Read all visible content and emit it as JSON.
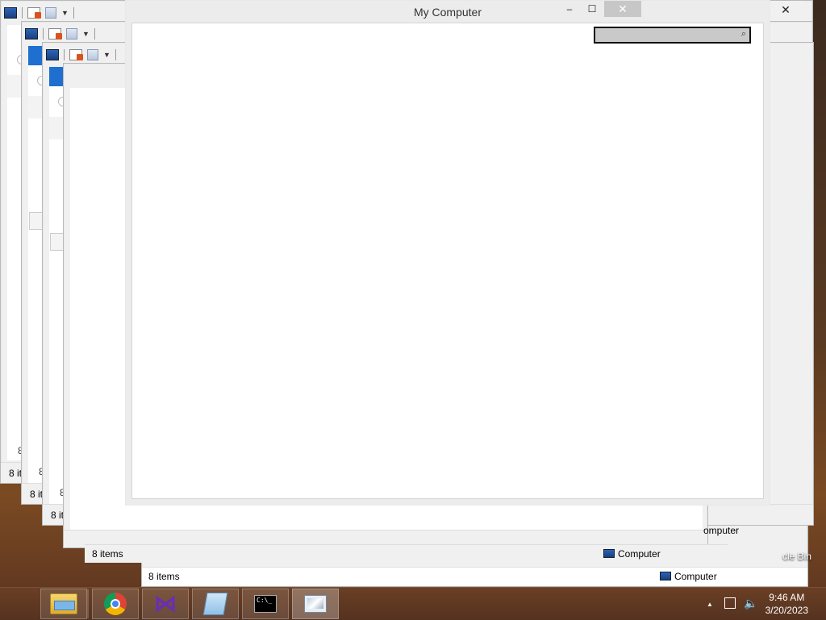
{
  "main_window": {
    "title": "My Computer",
    "controls": {
      "minimize": "‒",
      "maximize": "☐",
      "close": "✕"
    },
    "search": {
      "placeholder": ""
    }
  },
  "back_windows": {
    "status_items": "8 items",
    "status_items_truncated_1": "8 it",
    "status_items_truncated_2": "8 it",
    "status_items_truncated_3": "8 it",
    "status_digit_1": "8",
    "status_digit_2": "8",
    "status_digit_3": "8",
    "computer_label": "Computer",
    "computer_label_partial": "omputer",
    "close_glyph": "✕",
    "help_glyph": "?"
  },
  "desktop": {
    "recycle_bin_partial": "cle Bin"
  },
  "taskbar": {
    "apps": [
      {
        "name": "File Explorer"
      },
      {
        "name": "Google Chrome"
      },
      {
        "name": "Visual Studio"
      },
      {
        "name": "Notepad"
      },
      {
        "name": "Command Prompt"
      },
      {
        "name": "Performance Monitor"
      }
    ],
    "clock_time": "9:46 AM",
    "clock_date": "3/20/2023",
    "tray_up_arrow": "▲",
    "network_icon": "network",
    "volume_icon": "volume"
  }
}
